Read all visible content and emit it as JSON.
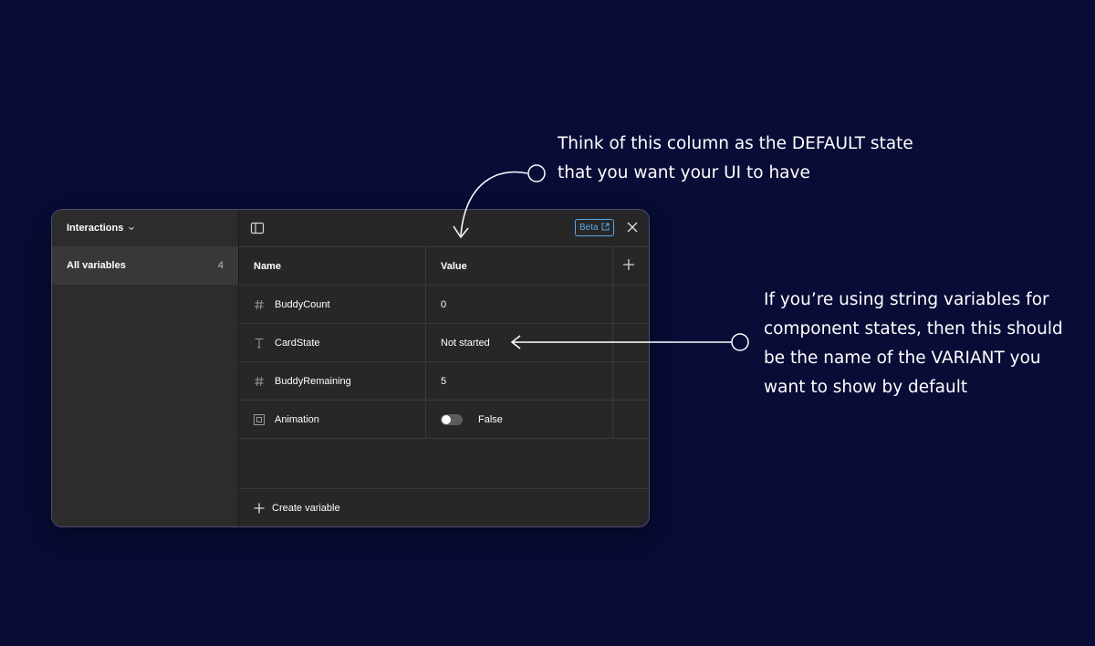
{
  "annotations": {
    "top": [
      "Think of this column as the DEFAULT state",
      "that you want your UI to have"
    ],
    "right": [
      "If you’re using string variables for",
      "component states, then this should",
      "be the name of the VARIANT you",
      "want to show by default"
    ]
  },
  "sidebar": {
    "collection": "Interactions",
    "items": [
      {
        "label": "All variables",
        "count": "4"
      }
    ]
  },
  "toolbar": {
    "beta_label": "Beta"
  },
  "table": {
    "headers": {
      "name": "Name",
      "value": "Value"
    },
    "rows": [
      {
        "icon": "number-icon",
        "name": "BuddyCount",
        "value": "0"
      },
      {
        "icon": "text-icon",
        "name": "CardState",
        "value": "Not started"
      },
      {
        "icon": "number-icon",
        "name": "BuddyRemaining",
        "value": "5"
      },
      {
        "icon": "boolean-icon",
        "name": "Animation",
        "value": "False",
        "toggle_on": false
      }
    ]
  },
  "footer": {
    "create_label": "Create variable"
  },
  "colors": {
    "background": "#080c36",
    "panel": "#2c2c2c",
    "accent": "#5aa7e6"
  }
}
